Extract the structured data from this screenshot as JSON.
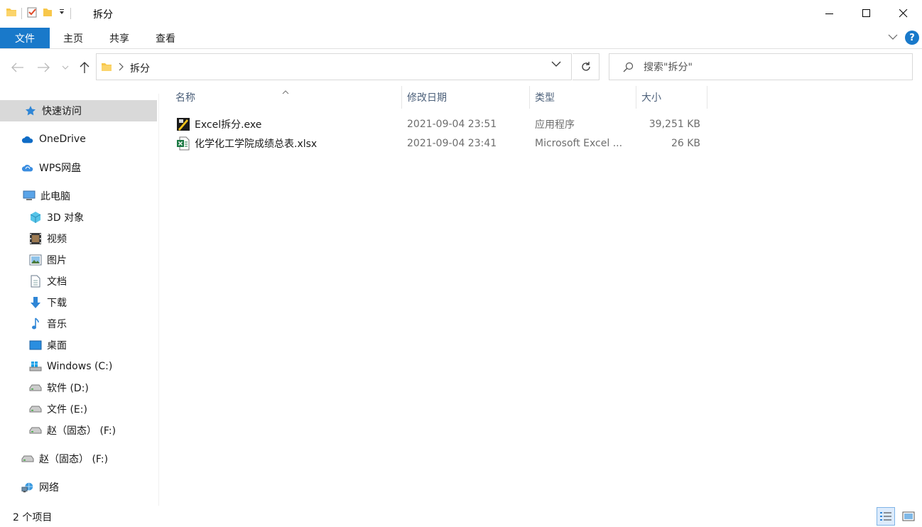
{
  "window": {
    "title": "拆分"
  },
  "ribbon": {
    "tabs": [
      "文件",
      "主页",
      "共享",
      "查看"
    ],
    "help_label": "?"
  },
  "address": {
    "crumb": "拆分"
  },
  "search": {
    "placeholder": "搜索\"拆分\""
  },
  "sidebar": {
    "items": [
      {
        "label": "快速访问",
        "icon": "star-icon"
      },
      {
        "label": "OneDrive",
        "icon": "onedrive-cloud-icon"
      },
      {
        "label": "WPS网盘",
        "icon": "wps-cloud-icon"
      },
      {
        "label": "此电脑",
        "icon": "computer-icon"
      },
      {
        "label": "3D 对象",
        "icon": "cube-3d-icon"
      },
      {
        "label": "视频",
        "icon": "video-icon"
      },
      {
        "label": "图片",
        "icon": "picture-icon"
      },
      {
        "label": "文档",
        "icon": "document-icon"
      },
      {
        "label": "下载",
        "icon": "download-arrow-icon"
      },
      {
        "label": "音乐",
        "icon": "music-note-icon"
      },
      {
        "label": "桌面",
        "icon": "desktop-icon"
      },
      {
        "label": "Windows (C:)",
        "icon": "windows-drive-icon"
      },
      {
        "label": "软件 (D:)",
        "icon": "drive-icon"
      },
      {
        "label": "文件 (E:)",
        "icon": "drive-icon"
      },
      {
        "label": "赵（固态） (F:)",
        "icon": "drive-icon"
      },
      {
        "label": "赵（固态） (F:)",
        "icon": "drive-icon"
      },
      {
        "label": "网络",
        "icon": "network-icon"
      }
    ]
  },
  "columns": {
    "name": "名称",
    "modified": "修改日期",
    "type": "类型",
    "size": "大小"
  },
  "files": [
    {
      "name": "Excel拆分.exe",
      "modified": "2021-09-04 23:51",
      "type": "应用程序",
      "size": "39,251 KB",
      "icon": "exe-app-icon"
    },
    {
      "name": "化学化工学院成绩总表.xlsx",
      "modified": "2021-09-04 23:41",
      "type": "Microsoft Excel ...",
      "size": "26 KB",
      "icon": "excel-file-icon"
    }
  ],
  "status": {
    "item_count": "2 个项目"
  },
  "colors": {
    "accent": "#1979ca",
    "folder": "#f8c74a",
    "selected_bg": "#d9d9d9"
  }
}
